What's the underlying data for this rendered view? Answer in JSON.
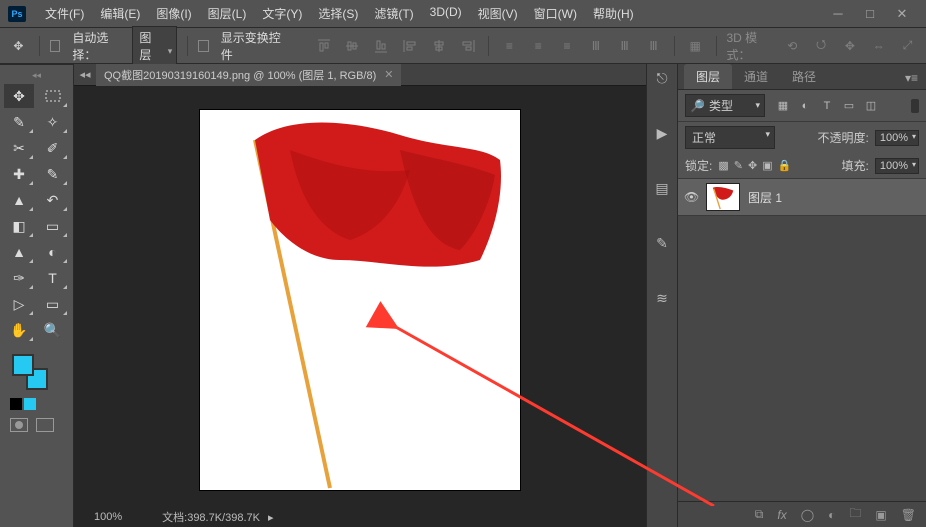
{
  "menu": [
    "文件(F)",
    "编辑(E)",
    "图像(I)",
    "图层(L)",
    "文字(Y)",
    "选择(S)",
    "滤镜(T)",
    "3D(D)",
    "视图(V)",
    "窗口(W)",
    "帮助(H)"
  ],
  "options": {
    "auto_select": "自动选择：",
    "target": "图层",
    "show_transform": "显示变换控件",
    "mode3d": "3D 模式："
  },
  "doc": {
    "title": "QQ截图20190319160149.png @ 100% (图层 1, RGB/8)"
  },
  "status": {
    "zoom": "100%",
    "docinfo": "文档:398.7K/398.7K"
  },
  "panels": {
    "tabs": [
      "图层",
      "通道",
      "路径"
    ],
    "filter_label": "类型",
    "blend": "正常",
    "opacity_label": "不透明度:",
    "opacity": "100%",
    "lock_label": "锁定:",
    "fill_label": "填充:",
    "fill": "100%",
    "layer_name": "图层 1"
  }
}
